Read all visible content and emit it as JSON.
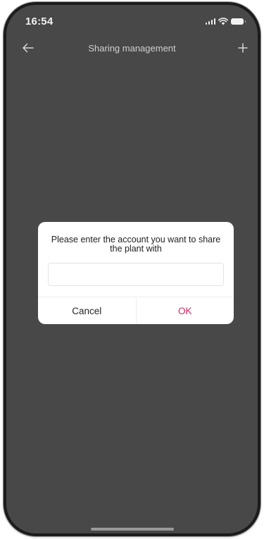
{
  "status_bar": {
    "time": "16:54",
    "icons": [
      "signal-icon",
      "wifi-icon",
      "battery-icon"
    ]
  },
  "nav": {
    "title": "Sharing management",
    "back_icon": "arrow-left-icon",
    "add_icon": "plus-icon"
  },
  "dialog": {
    "message": "Please enter the account you want to share the plant with",
    "input_value": "",
    "input_placeholder": "",
    "cancel_label": "Cancel",
    "ok_label": "OK"
  },
  "colors": {
    "overlay_background": "#484848",
    "dialog_background": "#ffffff",
    "accent": "#d0265f"
  }
}
